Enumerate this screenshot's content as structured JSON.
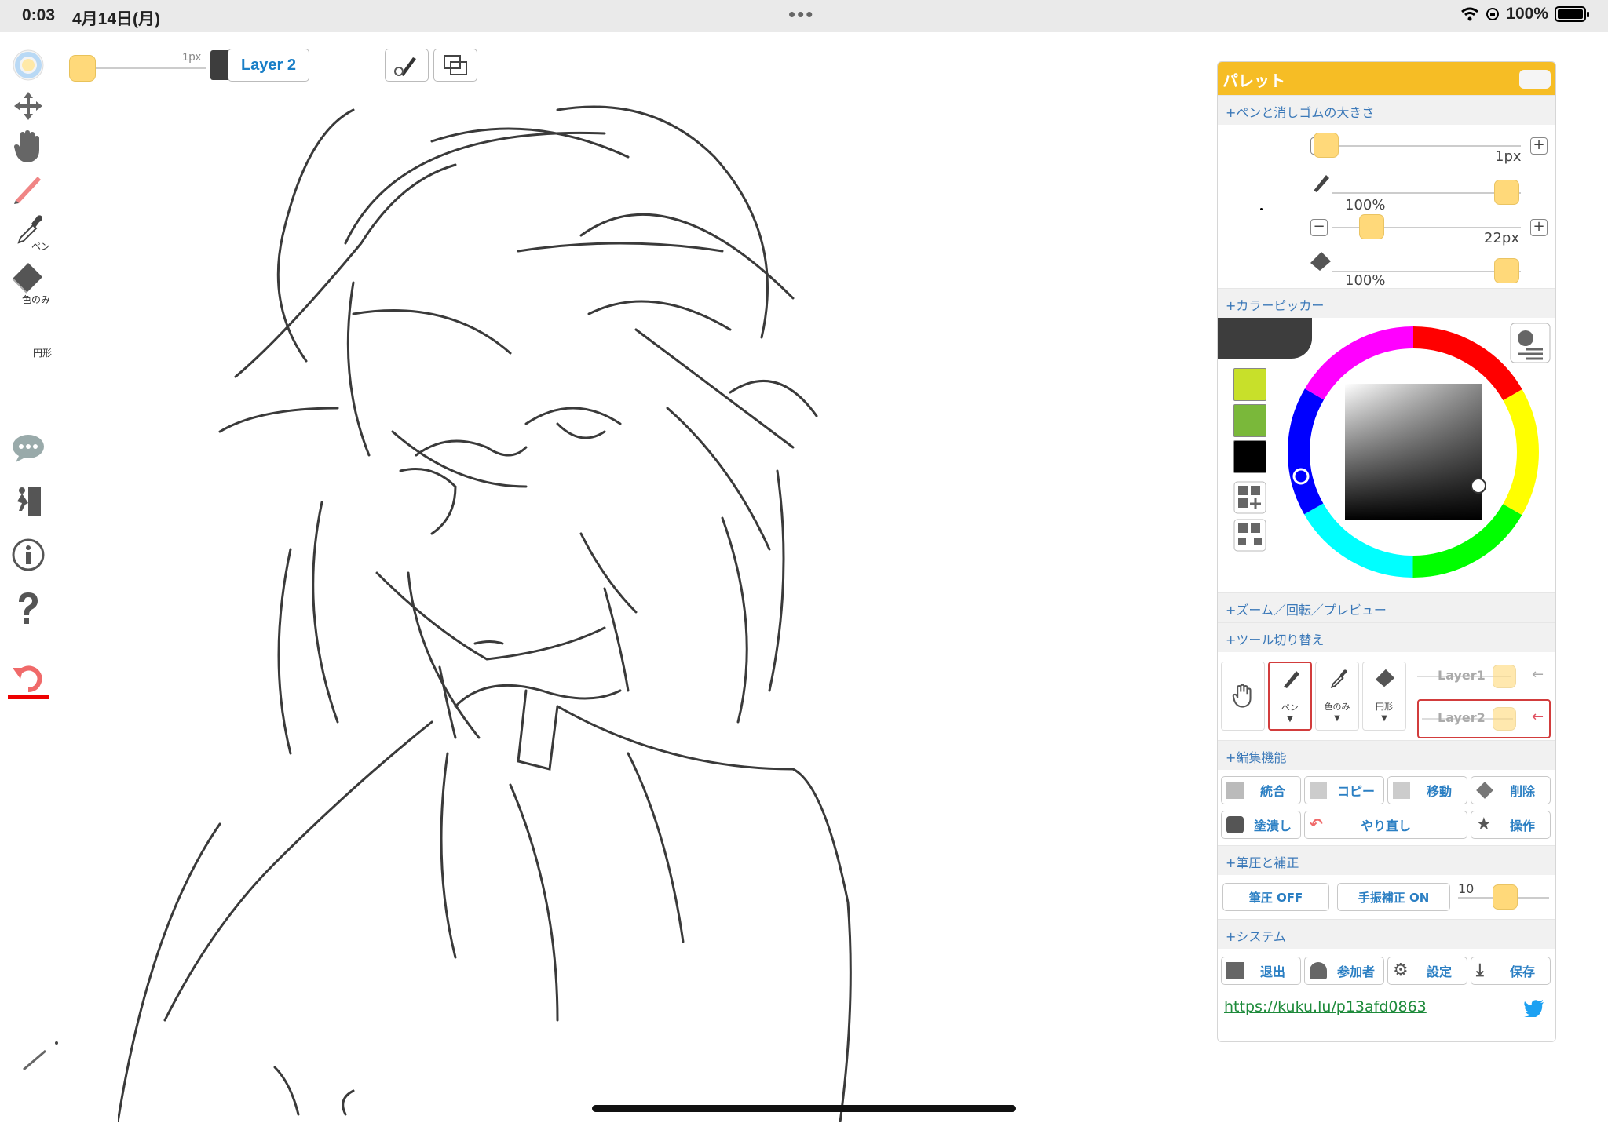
{
  "status": {
    "time": "0:03",
    "date": "4月14日(月)",
    "battery": "100%"
  },
  "left_toolbar": {
    "pen_label": "ペン",
    "picker_label": "色のみ",
    "eraser_label": "円形"
  },
  "top_controls": {
    "size": "1px",
    "layer": "Layer 2"
  },
  "palette": {
    "title": "パレット",
    "sections": {
      "pen_size": "+ペンと消しゴムの大きさ",
      "color_picker": "+カラーピッカー",
      "zoom": "+ズーム／回転／プレビュー",
      "tool_switch": "+ツール切り替え",
      "edit": "+編集機能",
      "pressure": "+筆圧と補正",
      "system": "+システム"
    },
    "pen": {
      "size": "1px",
      "opacity": "100%"
    },
    "eraser": {
      "size": "22px",
      "opacity": "100%"
    },
    "tools": {
      "pen": "ペン",
      "picker": "色のみ",
      "eraser": "円形"
    },
    "layers": [
      "Layer1",
      "Layer2"
    ],
    "edit_buttons": {
      "merge": "統合",
      "copy": "コピー",
      "move": "移動",
      "delete": "削除",
      "fill": "塗潰し",
      "redo": "やり直し",
      "operate": "操作"
    },
    "pressure": {
      "pressure_btn": "筆圧 OFF",
      "stabilizer_btn": "手振補正 ON",
      "stabilizer_value": "10"
    },
    "system_buttons": {
      "exit": "退出",
      "participants": "参加者",
      "settings": "設定",
      "save": "保存"
    },
    "link": "https://kuku.lu/p13afd0863"
  },
  "colors": {
    "accent": "#f6bd25",
    "swatches": [
      "#c8e02a",
      "#7ab83a",
      "#000000"
    ],
    "current": "#3d3d3d"
  }
}
